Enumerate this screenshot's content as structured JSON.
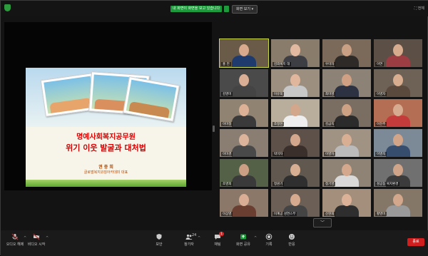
{
  "topbar": {
    "recording_banner": "내 화면이 화면을 보고 있습니다",
    "view_button": "화면 보기 ▾",
    "fullscreen": "⛶ 전체"
  },
  "slide": {
    "title_line1": "명예사회복지공무원",
    "title_line2": "위기 이웃 발굴과 대처법",
    "presenter_name": "권 중 희",
    "presenter_role": "글로벌복지코칭아카데미 대표"
  },
  "participants": [
    {
      "name": "홍 진",
      "skin": "#d8a98c",
      "shirt": "#1f3b6e",
      "bg": "#6a5b49"
    },
    {
      "name": "김외복지 대",
      "skin": "#e1b9a0",
      "shirt": "#3d3d44",
      "bg": "#8a7c6b"
    },
    {
      "name": "우미자",
      "skin": "#c9a084",
      "shirt": "#2e2a28",
      "bg": "#7b6a5a"
    },
    {
      "name": "이연",
      "skin": "#d6ab8e",
      "shirt": "#9c3d44",
      "bg": "#5c4f45"
    },
    {
      "name": "김영미",
      "skin": "#d9ae94",
      "shirt": "#444",
      "bg": "#4a4a4a"
    },
    {
      "name": "이유희",
      "skin": "#e0b79c",
      "shirt": "#c8c8c8",
      "bg": "#9d8f80"
    },
    {
      "name": "최미영",
      "skin": "#cfa084",
      "shirt": "#2c3242",
      "bg": "#8c8275"
    },
    {
      "name": "이영자",
      "skin": "#d8ad90",
      "shirt": "#5a4a3d",
      "bg": "#6e6156"
    },
    {
      "name": "이미정",
      "skin": "#dcb196",
      "shirt": "#3a3a3a",
      "bg": "#918372"
    },
    {
      "name": "조정현",
      "skin": "#d2a78b",
      "shirt": "#eeeeee",
      "bg": "#b9ad9c"
    },
    {
      "name": "김금옥",
      "skin": "#cda184",
      "shirt": "#2b2b2b",
      "bg": "#7a6d61"
    },
    {
      "name": "이진주",
      "skin": "#d7ab8f",
      "shirt": "#c43b3b",
      "bg": "#b46e54"
    },
    {
      "name": "이미경",
      "skin": "#dcb49b",
      "shirt": "#494949",
      "bg": "#8a7d72"
    },
    {
      "name": "박미자",
      "skin": "#d3a78c",
      "shirt": "#3a2f2a",
      "bg": "#5d5149"
    },
    {
      "name": "이영자",
      "skin": "#d9af94",
      "shirt": "#bbbbbb",
      "bg": "#a09383"
    },
    {
      "name": "이영옥",
      "skin": "#d2a589",
      "shirt": "#364d6e",
      "bg": "#7c8a97"
    },
    {
      "name": "조영희",
      "skin": "#cb9f84",
      "shirt": "#3a3a3a",
      "bg": "#556146"
    },
    {
      "name": "정원기",
      "skin": "#d8ae93",
      "shirt": "#2f2f2f",
      "bg": "#615850"
    },
    {
      "name": "정기영",
      "skin": "#d3a88c",
      "shirt": "#d9d9d9",
      "bg": "#8f8375"
    },
    {
      "name": "성공동 복지환경",
      "skin": "#d0a489",
      "shirt": "#3b3b3b",
      "bg": "#707070"
    },
    {
      "name": "이상영",
      "skin": "#d9ae95",
      "shirt": "#6a3e30",
      "bg": "#8b7868"
    },
    {
      "name": "이계공 성연스무",
      "skin": "#d5aa8e",
      "shirt": "#444444",
      "bg": "#6b5f56"
    },
    {
      "name": "신현희",
      "skin": "#dbb298",
      "shirt": "#2e2e2e",
      "bg": "#a38f7b"
    },
    {
      "name": "황영미",
      "skin": "#d2a78b",
      "shirt": "#9a9a9a",
      "bg": "#857767"
    }
  ],
  "controls": {
    "audio": "오디오 해제",
    "video": "비디오 시작",
    "security": "보안",
    "participants": "참가자",
    "participant_count": "24",
    "chat": "채팅",
    "chat_badge": "1",
    "share": "화면 공유",
    "record": "기록",
    "reactions": "반응",
    "end": "종료"
  },
  "colors": {
    "end": "#d11f1f",
    "share": "#1c9a3c",
    "active_speaker": "#c9d84a"
  }
}
